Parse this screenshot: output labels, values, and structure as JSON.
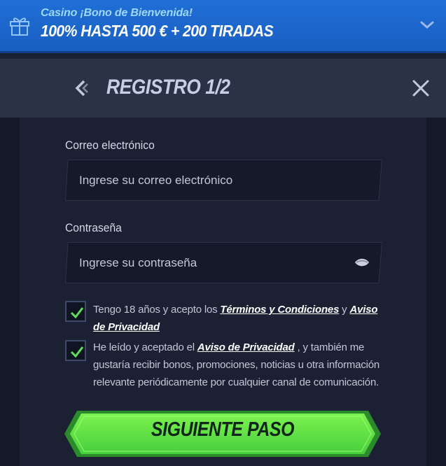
{
  "promo": {
    "subtitle": "Casino ¡Bono de Bienvenida!",
    "headline": "100% HASTA 500 € + 200 TIRADAS",
    "gift_icon": "gift-icon",
    "toggle_icon": "chevron-down-icon"
  },
  "header": {
    "title": "REGISTRO 1/2",
    "back_icon": "chevron-left-icon",
    "close_icon": "close-icon"
  },
  "form": {
    "email": {
      "label": "Correo electrónico",
      "placeholder": "Ingrese su correo electrónico",
      "value": ""
    },
    "password": {
      "label": "Contraseña",
      "placeholder": "Ingrese su contraseña",
      "value": "",
      "toggle_icon": "eye-icon"
    },
    "terms": {
      "checked": true,
      "text_before": "Tengo 18 años y acepto los ",
      "link1": "Términos y Condiciones",
      "text_middle": " y ",
      "link2": "Aviso de Privacidad"
    },
    "marketing": {
      "checked": true,
      "text_before": "He leído y aceptado el ",
      "link": "Aviso de Privacidad",
      "text_after": " , y también me gustaría recibir bonos, promociones, noticias u otra información relevante periódicamente por cualquier canal de comunicación."
    },
    "submit_label": "SIGUIENTE PASO"
  },
  "colors": {
    "promo_bg": "#1f6fd6",
    "header_bg": "#2c3246",
    "card_bg": "#1b2033",
    "checkbox_check": "#5ee05a",
    "cta_green": "#5fe84a"
  }
}
